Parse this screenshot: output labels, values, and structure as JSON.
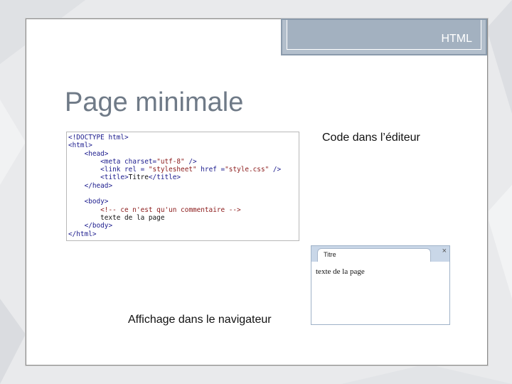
{
  "header": {
    "tab_label": "HTML"
  },
  "slide": {
    "title": "Page minimale",
    "caption_code": "Code dans l’éditeur",
    "caption_browser": "Affichage dans le navigateur"
  },
  "code_lines": [
    [
      {
        "t": "tag",
        "s": "<!DOCTYPE html>"
      }
    ],
    [
      {
        "t": "tag",
        "s": "<html>"
      }
    ],
    [
      {
        "t": "txt",
        "s": "    "
      },
      {
        "t": "tag",
        "s": "<head>"
      }
    ],
    [
      {
        "t": "txt",
        "s": "        "
      },
      {
        "t": "tag",
        "s": "<meta "
      },
      {
        "t": "attr",
        "s": "charset="
      },
      {
        "t": "str",
        "s": "\"utf-8\""
      },
      {
        "t": "tag",
        "s": " />"
      }
    ],
    [
      {
        "t": "txt",
        "s": "        "
      },
      {
        "t": "tag",
        "s": "<link "
      },
      {
        "t": "attr",
        "s": "rel = "
      },
      {
        "t": "str",
        "s": "\"stylesheet\""
      },
      {
        "t": "attr",
        "s": " href ="
      },
      {
        "t": "str",
        "s": "\"style.css\""
      },
      {
        "t": "tag",
        "s": " />"
      }
    ],
    [
      {
        "t": "txt",
        "s": "        "
      },
      {
        "t": "tag",
        "s": "<title>"
      },
      {
        "t": "txt",
        "s": "Titre"
      },
      {
        "t": "tag",
        "s": "</title>"
      }
    ],
    [
      {
        "t": "txt",
        "s": "    "
      },
      {
        "t": "tag",
        "s": "</head>"
      }
    ],
    [
      {
        "t": "txt",
        "s": ""
      }
    ],
    [
      {
        "t": "txt",
        "s": "    "
      },
      {
        "t": "tag",
        "s": "<body>"
      }
    ],
    [
      {
        "t": "txt",
        "s": "        "
      },
      {
        "t": "cmt",
        "s": "<!-- ce n'est qu'un commentaire -->"
      }
    ],
    [
      {
        "t": "txt",
        "s": "        texte de la page"
      }
    ],
    [
      {
        "t": "txt",
        "s": "    "
      },
      {
        "t": "tag",
        "s": "</body>"
      }
    ],
    [
      {
        "t": "tag",
        "s": "</html>"
      }
    ]
  ],
  "browser": {
    "tab_title": "Titre",
    "close_glyph": "×",
    "content_text": "texte de la page"
  }
}
